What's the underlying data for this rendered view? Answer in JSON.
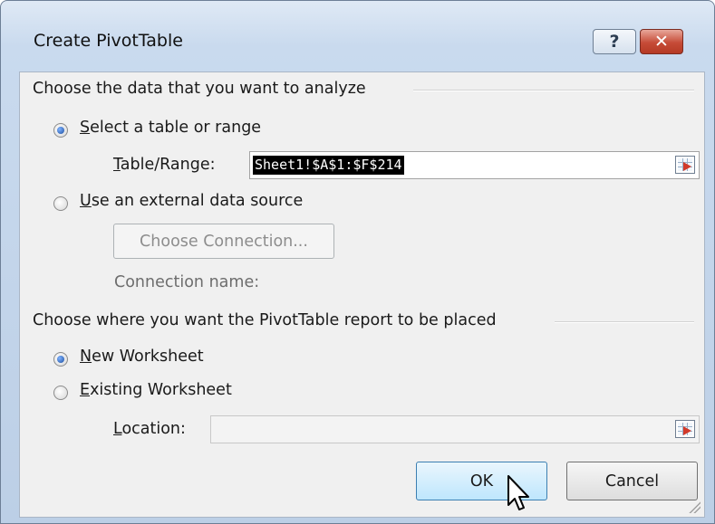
{
  "window": {
    "title": "Create PivotTable",
    "help_label": "?",
    "close_label": "✕"
  },
  "analyze_group": {
    "label": "Choose the data that you want to analyze",
    "select_table": {
      "accel": "S",
      "rest": "elect a table or range",
      "selected": true
    },
    "table_range": {
      "accel": "T",
      "rest": "able/Range:",
      "value": "Sheet1!$A$1:$F$214"
    },
    "external_source": {
      "accel": "U",
      "rest": "se an external data source",
      "selected": false
    },
    "choose_connection_label": "Choose Connection...",
    "connection_name_label": "Connection name:"
  },
  "placement_group": {
    "label": "Choose where you want the PivotTable report to be placed",
    "new_worksheet": {
      "accel": "N",
      "rest": "ew Worksheet",
      "selected": true
    },
    "existing_worksheet": {
      "accel": "E",
      "rest": "xisting Worksheet",
      "selected": false
    },
    "location": {
      "accel": "L",
      "rest": "ocation:",
      "value": ""
    }
  },
  "buttons": {
    "ok_label": "OK",
    "cancel_label": "Cancel"
  },
  "icons": {
    "range_selector": "collapse-dialog-icon",
    "cursor": "mouse-pointer-icon"
  }
}
